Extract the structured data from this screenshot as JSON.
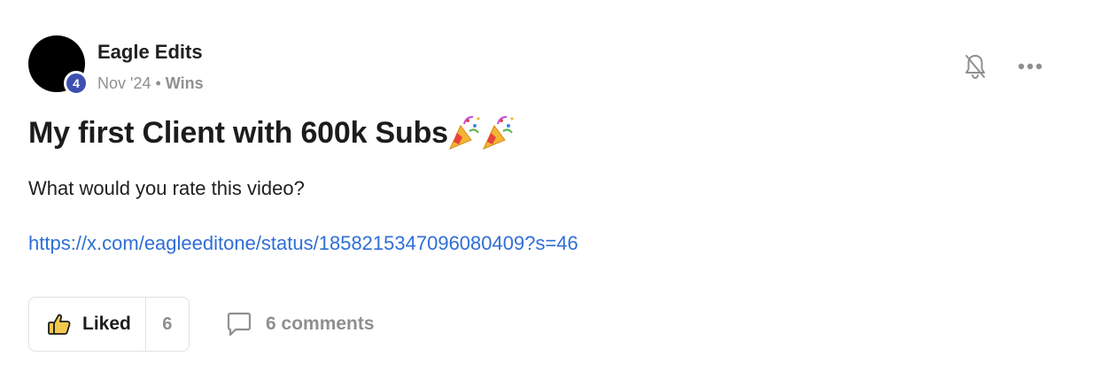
{
  "author": {
    "name": "Eagle Edits",
    "level": "4",
    "avatar_color": "#000000",
    "badge_color": "#3d4fb0"
  },
  "meta": {
    "date": "Nov '24",
    "separator": "•",
    "category": "Wins"
  },
  "actions": {
    "bell_icon": "bell-off-icon",
    "more_icon": "more-dots-icon"
  },
  "post": {
    "title": "My first Client with 600k Subs",
    "title_emoji": "party-popper-icon",
    "body": "What would you rate this video?",
    "link": "https://x.com/eagleeditone/status/1858215347096080409?s=46",
    "link_color": "#2f6fd6"
  },
  "footer": {
    "like_label": "Liked",
    "like_count": "6",
    "comments_label": "6 comments"
  }
}
